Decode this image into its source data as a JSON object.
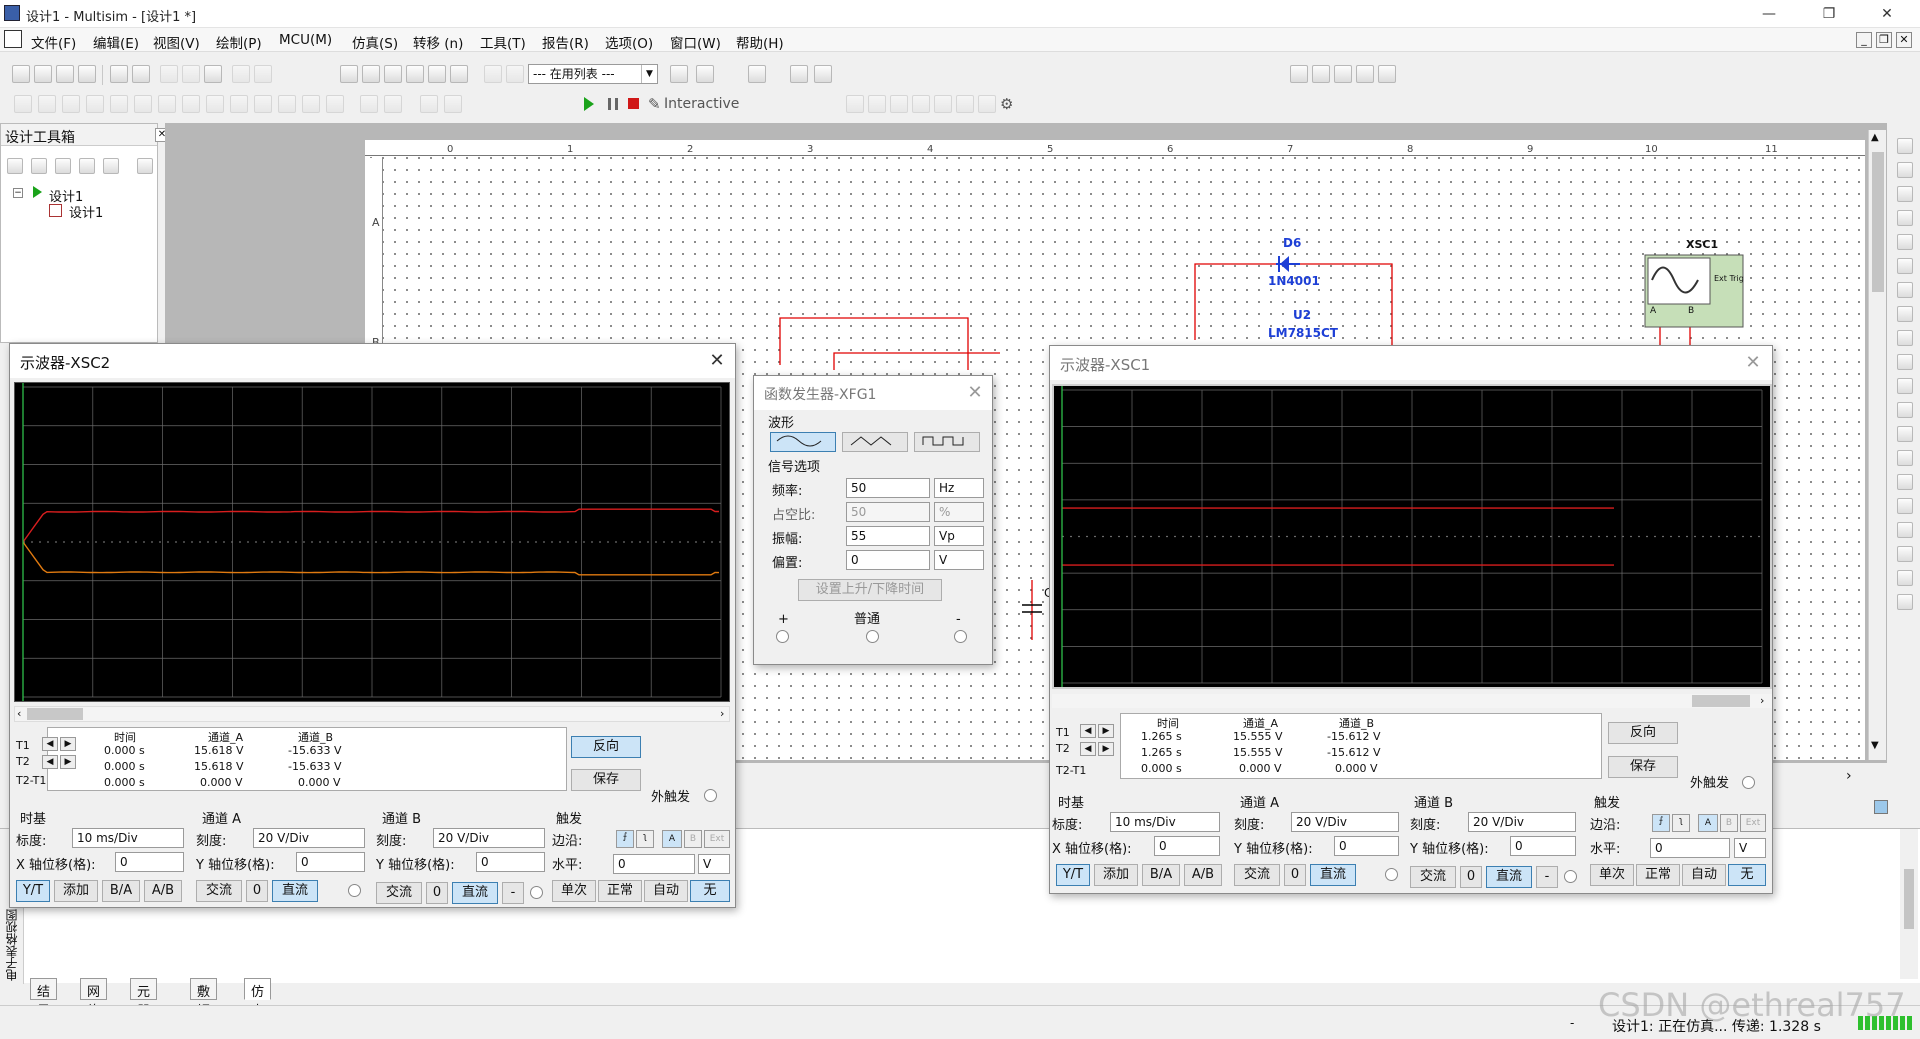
{
  "window": {
    "title": "设计1 - Multisim - [设计1 *]"
  },
  "menu": [
    "文件(F)",
    "编辑(E)",
    "视图(V)",
    "绘制(P)",
    "MCU(M)",
    "仿真(S)",
    "转移 (n)",
    "工具(T)",
    "报告(R)",
    "选项(O)",
    "窗口(W)",
    "帮助(H)"
  ],
  "toolbar": {
    "in_use_list": "--- 在用列表 ---",
    "interactive": "Interactive"
  },
  "toolbox": {
    "title": "设计工具箱",
    "tree_root": "设计1",
    "tree_child": "设计1"
  },
  "schematic": {
    "ruler": [
      "0",
      "1",
      "2",
      "3",
      "4",
      "5",
      "6",
      "7",
      "8",
      "9",
      "10",
      "11"
    ],
    "row_labels": [
      "A",
      "B"
    ],
    "d6_ref": "D6",
    "d6_val": "1N4001",
    "u2_ref": "U2",
    "u2_val": "LM7815CT",
    "xsc1_ref": "XSC1",
    "ext_trig": "Ext Trig",
    "chan_a": "A",
    "chan_b": "B",
    "cap_label": "C"
  },
  "xsc2": {
    "title": "示波器-XSC2",
    "headers": [
      "时间",
      "通道_A",
      "通道_B"
    ],
    "rows": [
      {
        "label": "T1",
        "time": "0.000 s",
        "a": "15.618 V",
        "b": "-15.633 V"
      },
      {
        "label": "T2",
        "time": "0.000 s",
        "a": "15.618 V",
        "b": "-15.633 V"
      },
      {
        "label": "T2-T1",
        "time": "0.000 s",
        "a": "0.000 V",
        "b": "0.000 V"
      }
    ],
    "reverse": "反向",
    "save": "保存",
    "ext_trigger": "外触发",
    "timebase": {
      "title": "时基",
      "scale_label": "标度:",
      "scale": "10 ms/Div",
      "xpos_label": "X 轴位移(格):",
      "xpos": "0",
      "buttons": [
        "Y/T",
        "添加",
        "B/A",
        "A/B"
      ]
    },
    "cha": {
      "title": "通道 A",
      "scale_label": "刻度:",
      "scale": "20  V/Div",
      "ypos_label": "Y 轴位移(格):",
      "ypos": "0",
      "buttons": [
        "交流",
        "0",
        "直流"
      ]
    },
    "chb": {
      "title": "通道 B",
      "scale_label": "刻度:",
      "scale": "20  V/Div",
      "ypos_label": "Y 轴位移(格):",
      "ypos": "0",
      "buttons": [
        "交流",
        "0",
        "直流",
        "-"
      ]
    },
    "trigger": {
      "title": "触发",
      "edge_label": "边沿:",
      "level_label": "水平:",
      "level": "0",
      "unit": "V",
      "sources": [
        "A",
        "B",
        "Ext"
      ],
      "modes": [
        "单次",
        "正常",
        "自动",
        "无"
      ]
    }
  },
  "xsc1": {
    "title": "示波器-XSC1",
    "headers": [
      "时间",
      "通道_A",
      "通道_B"
    ],
    "rows": [
      {
        "label": "T1",
        "time": "1.265 s",
        "a": "15.555 V",
        "b": "-15.612 V"
      },
      {
        "label": "T2",
        "time": "1.265 s",
        "a": "15.555 V",
        "b": "-15.612 V"
      },
      {
        "label": "T2-T1",
        "time": "0.000 s",
        "a": "0.000 V",
        "b": "0.000 V"
      }
    ],
    "reverse": "反向",
    "save": "保存",
    "ext_trigger": "外触发",
    "timebase": {
      "title": "时基",
      "scale_label": "标度:",
      "scale": "10 ms/Div",
      "xpos_label": "X 轴位移(格):",
      "xpos": "0",
      "buttons": [
        "Y/T",
        "添加",
        "B/A",
        "A/B"
      ]
    },
    "cha": {
      "title": "通道 A",
      "scale_label": "刻度:",
      "scale": "20  V/Div",
      "ypos_label": "Y 轴位移(格):",
      "ypos": "0",
      "buttons": [
        "交流",
        "0",
        "直流"
      ]
    },
    "chb": {
      "title": "通道 B",
      "scale_label": "刻度:",
      "scale": "20  V/Div",
      "ypos_label": "Y 轴位移(格):",
      "ypos": "0",
      "buttons": [
        "交流",
        "0",
        "直流",
        "-"
      ]
    },
    "trigger": {
      "title": "触发",
      "edge_label": "边沿:",
      "level_label": "水平:",
      "level": "0",
      "unit": "V",
      "sources": [
        "A",
        "B",
        "Ext"
      ],
      "modes": [
        "单次",
        "正常",
        "自动",
        "无"
      ]
    }
  },
  "xfg1": {
    "title": "函数发生器-XFG1",
    "waveform_label": "波形",
    "signal_label": "信号选项",
    "params": [
      {
        "label": "频率:",
        "value": "50",
        "unit": "Hz"
      },
      {
        "label": "占空比:",
        "value": "50",
        "unit": "%"
      },
      {
        "label": "振幅:",
        "value": "55",
        "unit": "Vp"
      },
      {
        "label": "偏置:",
        "value": "0",
        "unit": "V"
      }
    ],
    "rise_fall_button": "设置上升/下降时间",
    "plus": "+",
    "common": "普通",
    "minus": "-"
  },
  "output_panel": {
    "side_label": "电子表格视图",
    "tabs": [
      "结果",
      "网络",
      "元器件",
      "敷铜层",
      "仿真"
    ]
  },
  "status": {
    "text": "设计1: 正在仿真... 传递: 1.328 s",
    "dash": "-",
    "watermark": "CSDN @ethreal757"
  },
  "colors": {
    "trace_a": "#d81e1e",
    "trace_b": "#e07a10",
    "grid": "#6a6a6a",
    "screen": "#000000",
    "wire": "#e00000",
    "component": "#1d3fd6"
  },
  "chart_data": {
    "type": "line",
    "xsc2": {
      "timebase": "10 ms/Div",
      "channel_a_volts": 15.618,
      "channel_b_volts": -15.633
    },
    "xsc1": {
      "timebase": "10 ms/Div",
      "channel_a_volts": 15.555,
      "channel_b_volts": -15.612
    }
  }
}
